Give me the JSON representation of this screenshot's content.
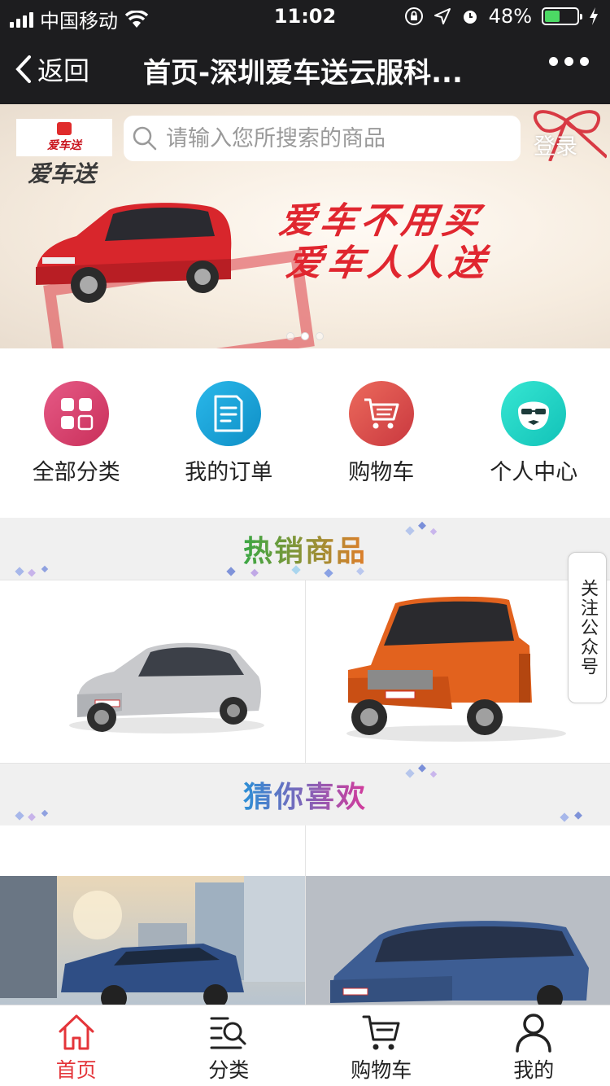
{
  "status_bar": {
    "carrier": "中国移动",
    "time": "11:02",
    "battery_percent": "48%",
    "battery_level": 0.48
  },
  "nav": {
    "back_label": "返回",
    "title": "首页-深圳爱车送云服科..."
  },
  "banner": {
    "logo_text": "爱车送",
    "search_placeholder": "请输入您所搜索的商品",
    "login_label": "登录",
    "slogan_line1": "爱车不用买",
    "slogan_line2": "爱车人人送",
    "active_slide": 2,
    "slide_count": 3
  },
  "quick_menu": [
    {
      "label": "全部分类",
      "icon": "grid-icon",
      "color": "#d9436c"
    },
    {
      "label": "我的订单",
      "icon": "document-icon",
      "color": "#1aa3d8"
    },
    {
      "label": "购物车",
      "icon": "cart-icon",
      "color": "#e0524e"
    },
    {
      "label": "个人中心",
      "icon": "face-icon",
      "color": "#22d8c8"
    }
  ],
  "hot_section": {
    "title": "热销商品"
  },
  "guess_section": {
    "title": "猜你喜欢"
  },
  "follow_label": "关注公众号",
  "tabbar": [
    {
      "label": "首页",
      "icon": "home-icon",
      "active": true
    },
    {
      "label": "分类",
      "icon": "category-search-icon",
      "active": false
    },
    {
      "label": "购物车",
      "icon": "cart-icon",
      "active": false
    },
    {
      "label": "我的",
      "icon": "user-icon",
      "active": false
    }
  ],
  "colors": {
    "accent": "#e4353a",
    "nav_bg": "#1d1d1f",
    "hot_title_start": "#3aa744",
    "hot_title_end": "#e07e2a",
    "guess_title_start": "#2c8fd6",
    "guess_title_end": "#d43a9b"
  }
}
